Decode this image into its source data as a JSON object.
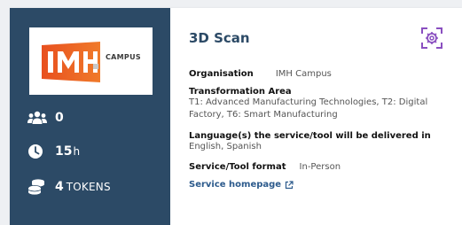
{
  "provider": {
    "logo_text": "IMH",
    "logo_subtext": "CAMPUS"
  },
  "stats": {
    "participants": "0",
    "hours_value": "15",
    "hours_unit": "h",
    "tokens_value": "4",
    "tokens_unit": "TOKENS"
  },
  "service": {
    "title": "3D Scan",
    "organisation_label": "Organisation",
    "organisation_value": "IMH Campus",
    "area_label": "Transformation Area",
    "area_value": "T1: Advanced Manufacturing Technologies, T2: Digital Factory, T6: Smart Manufacturing",
    "language_label": "Language(s) the service/tool will be delivered in",
    "language_value": "English, Spanish",
    "format_label": "Service/Tool format",
    "format_value": "In-Person",
    "homepage_label": "Service homepage"
  },
  "icons": {
    "participants": "users-icon",
    "hours": "clock-icon",
    "tokens": "coins-icon",
    "scan": "scan-gear-icon",
    "external": "external-link-icon"
  },
  "colors": {
    "panel": "#2c4a66",
    "title": "#2c4a66",
    "accent_icon": "#8a4fc0",
    "logo_orange": "#e8501f"
  }
}
